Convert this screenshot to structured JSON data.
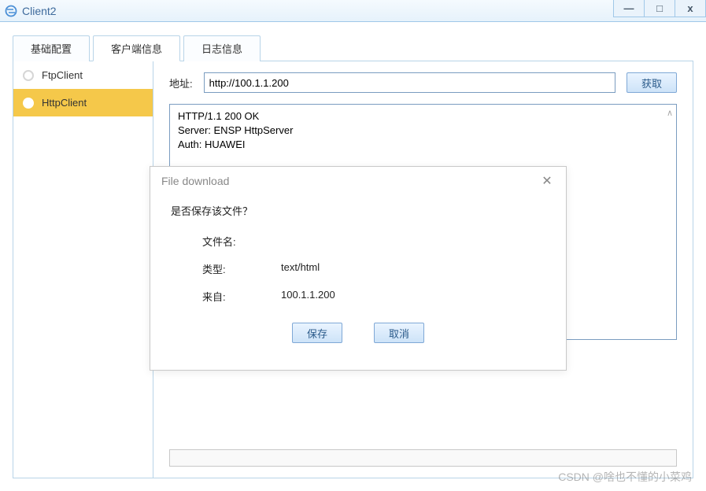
{
  "window": {
    "title": "Client2",
    "controls": {
      "min": "—",
      "max": "□",
      "close": "x"
    }
  },
  "tabs": [
    {
      "label": "基础配置",
      "active": false
    },
    {
      "label": "客户端信息",
      "active": true
    },
    {
      "label": "日志信息",
      "active": false
    }
  ],
  "sidebar": {
    "items": [
      {
        "label": "FtpClient",
        "active": false
      },
      {
        "label": "HttpClient",
        "active": true
      }
    ]
  },
  "address": {
    "label": "地址:",
    "value": "http://100.1.1.200",
    "get_btn": "获取"
  },
  "response": {
    "lines": [
      "HTTP/1.1 200 OK",
      "Server: ENSP HttpServer",
      "Auth: HUAWEI"
    ],
    "scroll_hint": "∧"
  },
  "dialog": {
    "title": "File download",
    "question": "是否保存该文件？",
    "filename_label": "文件名:",
    "filename_value": "",
    "type_label": "类型:",
    "type_value": "text/html",
    "from_label": "来自:",
    "from_value": "100.1.1.200",
    "save_btn": "保存",
    "cancel_btn": "取消"
  },
  "watermark": "CSDN @啥也不懂的小菜鸡"
}
